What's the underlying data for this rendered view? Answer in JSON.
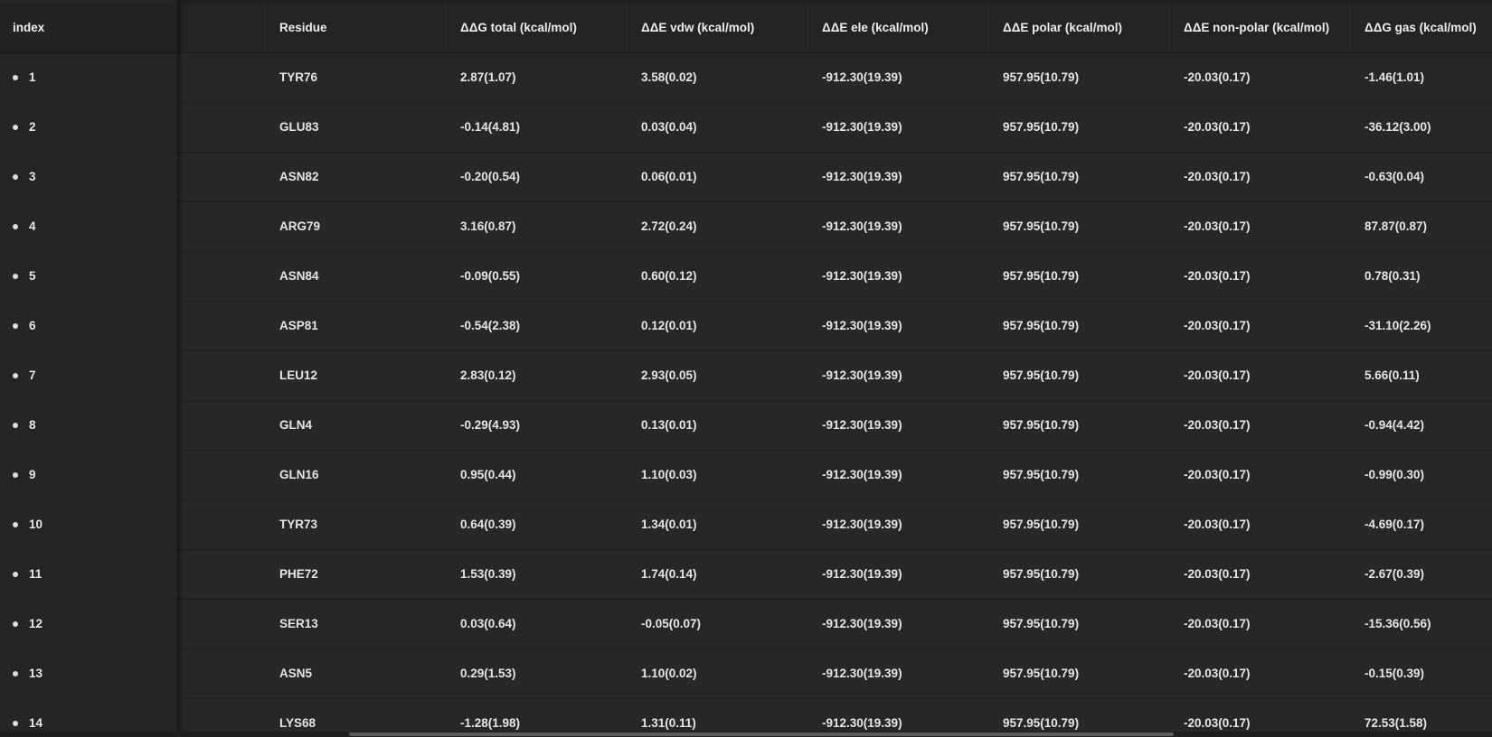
{
  "table": {
    "headers": {
      "index": "index",
      "residue": "Residue",
      "dg_total": "ΔΔG total (kcal/mol)",
      "de_vdw": "ΔΔE vdw (kcal/mol)",
      "de_ele": "ΔΔE ele (kcal/mol)",
      "de_polar": "ΔΔE polar (kcal/mol)",
      "de_nonpolar": "ΔΔE non-polar (kcal/mol)",
      "dg_gas": "ΔΔG gas (kcal/mol)"
    },
    "rows": [
      {
        "index": "1",
        "residue": "TYR76",
        "dg_total": "2.87(1.07)",
        "de_vdw": "3.58(0.02)",
        "de_ele": "-912.30(19.39)",
        "de_polar": "957.95(10.79)",
        "de_nonpolar": "-20.03(0.17)",
        "dg_gas": "-1.46(1.01)"
      },
      {
        "index": "2",
        "residue": "GLU83",
        "dg_total": "-0.14(4.81)",
        "de_vdw": "0.03(0.04)",
        "de_ele": "-912.30(19.39)",
        "de_polar": "957.95(10.79)",
        "de_nonpolar": "-20.03(0.17)",
        "dg_gas": "-36.12(3.00)"
      },
      {
        "index": "3",
        "residue": "ASN82",
        "dg_total": "-0.20(0.54)",
        "de_vdw": "0.06(0.01)",
        "de_ele": "-912.30(19.39)",
        "de_polar": "957.95(10.79)",
        "de_nonpolar": "-20.03(0.17)",
        "dg_gas": "-0.63(0.04)"
      },
      {
        "index": "4",
        "residue": "ARG79",
        "dg_total": "3.16(0.87)",
        "de_vdw": "2.72(0.24)",
        "de_ele": "-912.30(19.39)",
        "de_polar": "957.95(10.79)",
        "de_nonpolar": "-20.03(0.17)",
        "dg_gas": "87.87(0.87)"
      },
      {
        "index": "5",
        "residue": "ASN84",
        "dg_total": "-0.09(0.55)",
        "de_vdw": "0.60(0.12)",
        "de_ele": "-912.30(19.39)",
        "de_polar": "957.95(10.79)",
        "de_nonpolar": "-20.03(0.17)",
        "dg_gas": "0.78(0.31)"
      },
      {
        "index": "6",
        "residue": "ASP81",
        "dg_total": "-0.54(2.38)",
        "de_vdw": "0.12(0.01)",
        "de_ele": "-912.30(19.39)",
        "de_polar": "957.95(10.79)",
        "de_nonpolar": "-20.03(0.17)",
        "dg_gas": "-31.10(2.26)"
      },
      {
        "index": "7",
        "residue": "LEU12",
        "dg_total": "2.83(0.12)",
        "de_vdw": "2.93(0.05)",
        "de_ele": "-912.30(19.39)",
        "de_polar": "957.95(10.79)",
        "de_nonpolar": "-20.03(0.17)",
        "dg_gas": "5.66(0.11)"
      },
      {
        "index": "8",
        "residue": "GLN4",
        "dg_total": "-0.29(4.93)",
        "de_vdw": "0.13(0.01)",
        "de_ele": "-912.30(19.39)",
        "de_polar": "957.95(10.79)",
        "de_nonpolar": "-20.03(0.17)",
        "dg_gas": "-0.94(4.42)"
      },
      {
        "index": "9",
        "residue": "GLN16",
        "dg_total": "0.95(0.44)",
        "de_vdw": "1.10(0.03)",
        "de_ele": "-912.30(19.39)",
        "de_polar": "957.95(10.79)",
        "de_nonpolar": "-20.03(0.17)",
        "dg_gas": "-0.99(0.30)"
      },
      {
        "index": "10",
        "residue": "TYR73",
        "dg_total": "0.64(0.39)",
        "de_vdw": "1.34(0.01)",
        "de_ele": "-912.30(19.39)",
        "de_polar": "957.95(10.79)",
        "de_nonpolar": "-20.03(0.17)",
        "dg_gas": "-4.69(0.17)"
      },
      {
        "index": "11",
        "residue": "PHE72",
        "dg_total": "1.53(0.39)",
        "de_vdw": "1.74(0.14)",
        "de_ele": "-912.30(19.39)",
        "de_polar": "957.95(10.79)",
        "de_nonpolar": "-20.03(0.17)",
        "dg_gas": "-2.67(0.39)"
      },
      {
        "index": "12",
        "residue": "SER13",
        "dg_total": "0.03(0.64)",
        "de_vdw": "-0.05(0.07)",
        "de_ele": "-912.30(19.39)",
        "de_polar": "957.95(10.79)",
        "de_nonpolar": "-20.03(0.17)",
        "dg_gas": "-15.36(0.56)"
      },
      {
        "index": "13",
        "residue": "ASN5",
        "dg_total": "0.29(1.53)",
        "de_vdw": "1.10(0.02)",
        "de_ele": "-912.30(19.39)",
        "de_polar": "957.95(10.79)",
        "de_nonpolar": "-20.03(0.17)",
        "dg_gas": "-0.15(0.39)"
      },
      {
        "index": "14",
        "residue": "LYS68",
        "dg_total": "-1.28(1.98)",
        "de_vdw": "1.31(0.11)",
        "de_ele": "-912.30(19.39)",
        "de_polar": "957.95(10.79)",
        "de_nonpolar": "-20.03(0.17)",
        "dg_gas": "72.53(1.58)"
      }
    ]
  },
  "colors": {
    "background": "#272727",
    "header_background": "#232323",
    "text": "#e6e6e6",
    "scrollbar_thumb": "#5a5a5a"
  }
}
